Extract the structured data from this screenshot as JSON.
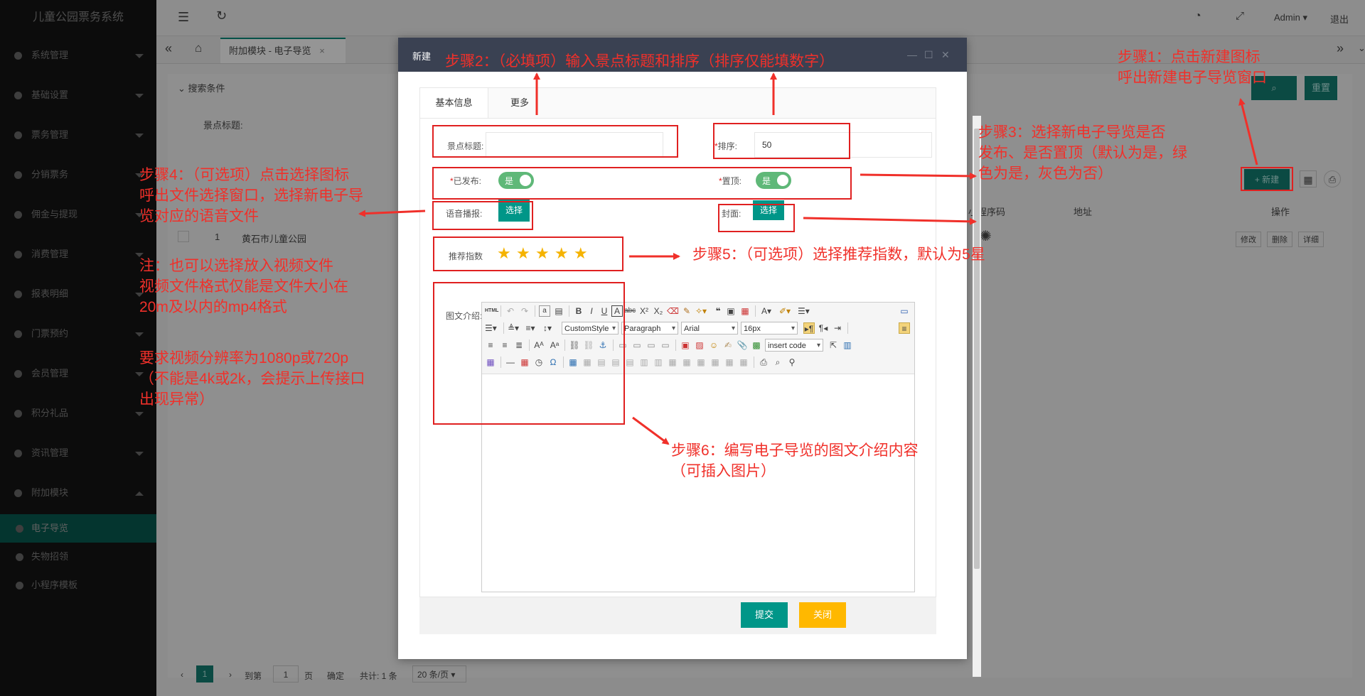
{
  "app": {
    "title": "儿童公园票务系统",
    "user": "Admin",
    "logout": "退出"
  },
  "sidebar": {
    "items": [
      {
        "label": "系统管理"
      },
      {
        "label": "基础设置"
      },
      {
        "label": "票务管理"
      },
      {
        "label": "分销票务"
      },
      {
        "label": "佣金与提现"
      },
      {
        "label": "消费管理"
      },
      {
        "label": "报表明细"
      },
      {
        "label": "门票预约"
      },
      {
        "label": "会员管理"
      },
      {
        "label": "积分礼品"
      },
      {
        "label": "资讯管理"
      },
      {
        "label": "附加模块"
      }
    ],
    "sub_items": [
      {
        "label": "电子导览"
      },
      {
        "label": "失物招领"
      },
      {
        "label": "小程序模板"
      }
    ]
  },
  "page": {
    "tab_label": "附加模块 - 电子导览",
    "search": {
      "section": "搜索条件",
      "field_label": "景点标题:",
      "reset": "重置"
    },
    "toolbar": {
      "new_label": "+ 新建"
    },
    "table": {
      "headers": [
        "小程序码",
        "地址",
        "操作"
      ],
      "row": {
        "index": "1",
        "title": "黄石市儿童公园",
        "actions": [
          "修改",
          "删除",
          "详细"
        ]
      }
    },
    "pagination": {
      "current": "1",
      "goto_label": "到第",
      "goto_value": "1",
      "page_unit": "页",
      "confirm": "确定",
      "total": "共计: 1 条",
      "page_size": "20 条/页"
    }
  },
  "modal": {
    "title": "新建",
    "tabs": [
      "基本信息",
      "更多"
    ],
    "fields": {
      "title_label": "景点标题:",
      "sort_label": "排序:",
      "sort_value": "50",
      "published_label": "已发布:",
      "top_label": "置顶:",
      "switch_text": "是",
      "audio_label": "语音播报:",
      "cover_label": "封面:",
      "pick": "选择",
      "rating_label": "推荐指数",
      "rating_value": 5,
      "intro_label": "图文介绍:"
    },
    "editor": {
      "custom_style": "CustomStyle",
      "paragraph": "Paragraph",
      "font": "Arial",
      "size": "16px",
      "insert_code": "insert code"
    },
    "buttons": {
      "submit": "提交",
      "close": "关闭"
    }
  },
  "annotations": {
    "step1": [
      "步骤1：点击新建图标",
      "呼出新建电子导览窗口"
    ],
    "step2": "步骤2：（必填项）输入景点标题和排序（排序仅能填数字）",
    "step3": [
      "步骤3：选择新电子导览是否",
      "发布、是否置顶（默认为是，绿",
      "色为是，灰色为否）"
    ],
    "step4": [
      "步骤4：（可选项）点击选择图标",
      "呼出文件选择窗口，选择新电子导",
      "览对应的语音文件"
    ],
    "note": [
      "注：也可以选择放入视频文件",
      "视频文件格式仅能是文件大小在",
      "20m及以内的mp4格式"
    ],
    "req": [
      "要求视频分辨率为1080p或720p",
      "（不能是4k或2k，会提示上传接口",
      "出现异常）"
    ],
    "step5": "步骤5：（可选项）选择推荐指数，默认为5星",
    "step6": [
      "步骤6：编写电子导览的图文介绍内容",
      "（可插入图片）"
    ]
  },
  "colors": {
    "accent": "#009688",
    "annotation": "#e02020",
    "switch_on": "#5fb878",
    "close_btn": "#ffb800",
    "modal_header": "#3a4152"
  }
}
